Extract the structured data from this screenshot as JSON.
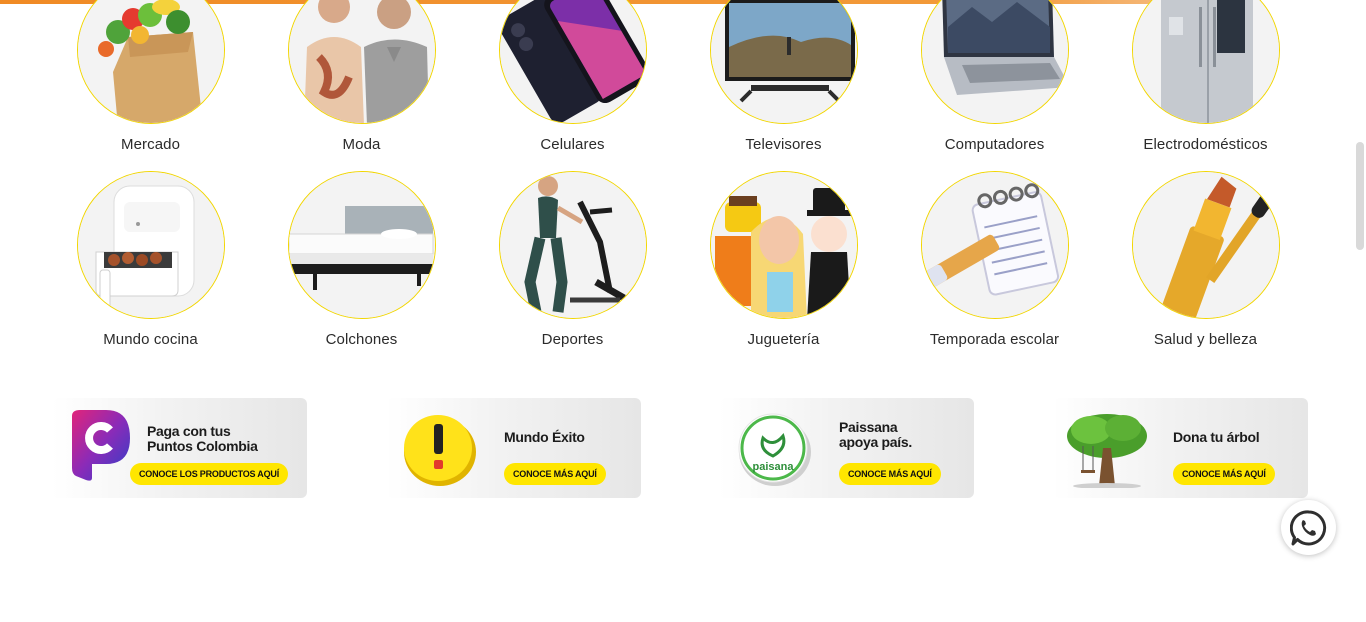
{
  "categories_row1": [
    {
      "label": "Mercado",
      "icon": "grocery-bag-icon"
    },
    {
      "label": "Moda",
      "icon": "fashion-couple-icon"
    },
    {
      "label": "Celulares",
      "icon": "smartphone-icon"
    },
    {
      "label": "Televisores",
      "icon": "television-icon"
    },
    {
      "label": "Computadores",
      "icon": "laptop-icon"
    },
    {
      "label": "Electrodomésticos",
      "icon": "refrigerator-icon"
    }
  ],
  "categories_row2": [
    {
      "label": "Mundo cocina",
      "icon": "air-fryer-icon"
    },
    {
      "label": "Colchones",
      "icon": "mattress-icon"
    },
    {
      "label": "Deportes",
      "icon": "elliptical-trainer-icon"
    },
    {
      "label": "Juguetería",
      "icon": "toys-icon"
    },
    {
      "label": "Temporada escolar",
      "icon": "notebook-pencil-icon"
    },
    {
      "label": "Salud y belleza",
      "icon": "lipstick-mascara-icon"
    }
  ],
  "banners": [
    {
      "title_line1": "Paga con tus",
      "title_line2": "Puntos Colombia",
      "cta": "CONOCE LOS PRODUCTOS AQUÍ"
    },
    {
      "title_line1": "Mundo Éxito",
      "title_line2": "",
      "cta": "CONOCE MÁS AQUÍ"
    },
    {
      "title_line1": "Paissana",
      "title_line2": "apoya país.",
      "cta": "CONOCE MÁS AQUÍ",
      "logo_text": "paisana"
    },
    {
      "title_line1": "Dona tu árbol",
      "title_line2": "",
      "cta": "CONOCE MÁS AQUÍ"
    }
  ],
  "colors": {
    "accent_yellow": "#ffe600",
    "progress_orange": "#f08a24",
    "circle_border": "#f2d600"
  }
}
